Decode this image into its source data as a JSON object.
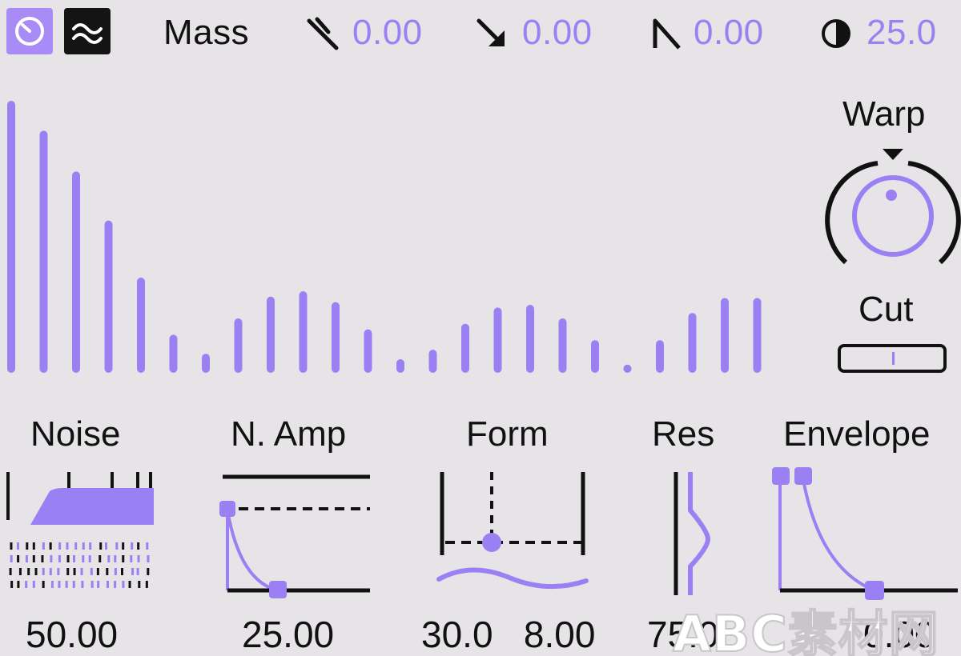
{
  "header": {
    "mode_a_icon": "tempo-dial-icon",
    "mode_b_icon": "wave-icon",
    "title": "Mass",
    "params": [
      {
        "icon": "tuning-fork-icon",
        "value": "0.00"
      },
      {
        "icon": "arrow-down-right-icon",
        "value": "0.00"
      },
      {
        "icon": "decay-slope-icon",
        "value": "0.00"
      },
      {
        "icon": "half-circle-icon",
        "value": "25.0"
      }
    ]
  },
  "spectrum": {
    "bar_color": "#9a80f3",
    "levels": [
      1.0,
      0.89,
      0.74,
      0.56,
      0.35,
      0.14,
      0.07,
      0.2,
      0.28,
      0.3,
      0.26,
      0.16,
      0.05,
      0.085,
      0.18,
      0.24,
      0.25,
      0.2,
      0.12,
      0.03,
      0.12,
      0.22,
      0.275,
      0.275
    ]
  },
  "warp": {
    "label": "Warp"
  },
  "cut": {
    "label": "Cut"
  },
  "panels": [
    {
      "label": "Noise",
      "value": "50.00"
    },
    {
      "label": "N. Amp",
      "value": "25.00"
    },
    {
      "label": "Form",
      "value": "30.0   8.00"
    },
    {
      "label": "Res",
      "value": "75.0"
    },
    {
      "label": "Envelope",
      "value": "0.00"
    }
  ],
  "watermark": "ABC素材网",
  "colors": {
    "accent": "#9a80f3",
    "background": "#e7e4e8",
    "ink": "#111111"
  }
}
